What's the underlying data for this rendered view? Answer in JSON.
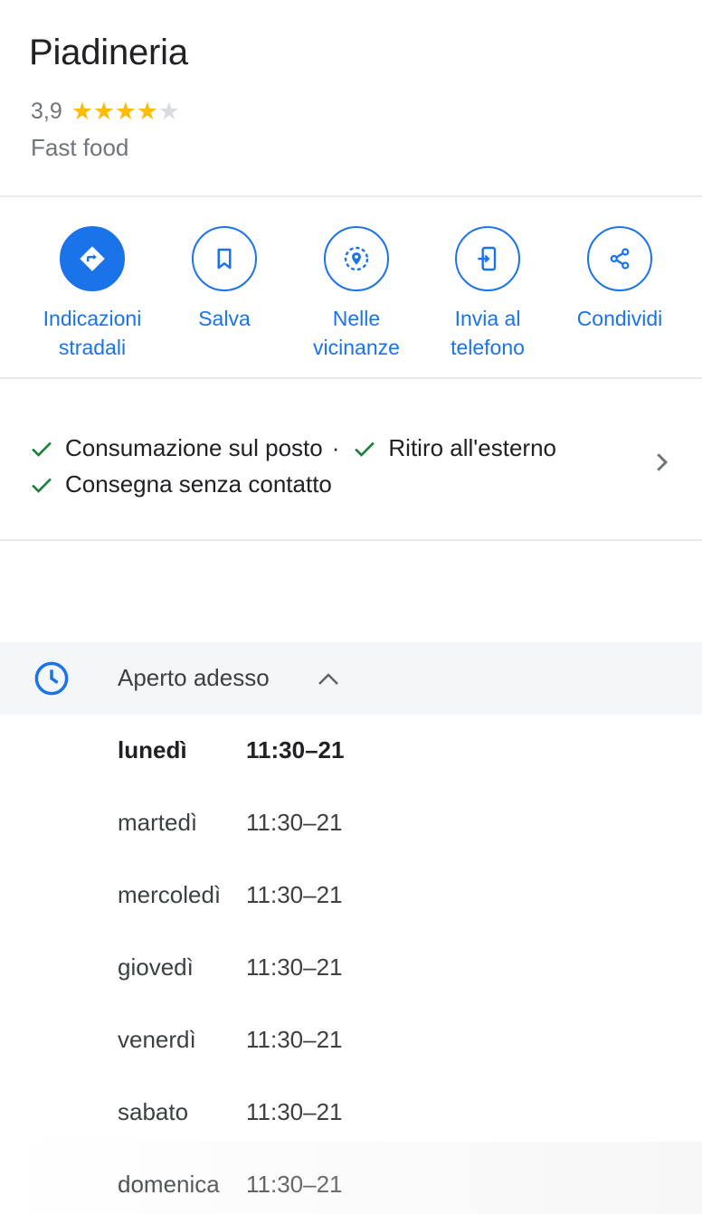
{
  "place": {
    "title": "Piadineria",
    "rating": "3,9",
    "rating_value": 3.9,
    "stars_filled": 4,
    "stars_total": 5,
    "category": "Fast food"
  },
  "actions": [
    {
      "id": "directions",
      "label": "Indicazioni stradali",
      "icon": "directions-icon"
    },
    {
      "id": "save",
      "label": "Salva",
      "icon": "bookmark-icon"
    },
    {
      "id": "nearby",
      "label": "Nelle vicinanze",
      "icon": "nearby-icon"
    },
    {
      "id": "send",
      "label": "Invia al telefono",
      "icon": "send-to-phone-icon"
    },
    {
      "id": "share",
      "label": "Condividi",
      "icon": "share-icon"
    }
  ],
  "services": {
    "items": [
      "Consumazione sul posto",
      "Ritiro all'esterno",
      "Consegna senza contatto"
    ],
    "separator": "·"
  },
  "hours": {
    "status": "Aperto adesso",
    "days": [
      {
        "day": "lunedì",
        "time": "11:30–21",
        "today": true
      },
      {
        "day": "martedì",
        "time": "11:30–21",
        "today": false
      },
      {
        "day": "mercoledì",
        "time": "11:30–21",
        "today": false
      },
      {
        "day": "giovedì",
        "time": "11:30–21",
        "today": false
      },
      {
        "day": "venerdì",
        "time": "11:30–21",
        "today": false
      },
      {
        "day": "sabato",
        "time": "11:30–21",
        "today": false
      },
      {
        "day": "domenica",
        "time": "11:30–21",
        "today": false
      }
    ]
  },
  "colors": {
    "accent": "#1a73e8",
    "star": "#fbbc04",
    "check": "#188038",
    "muted": "#70757a"
  }
}
